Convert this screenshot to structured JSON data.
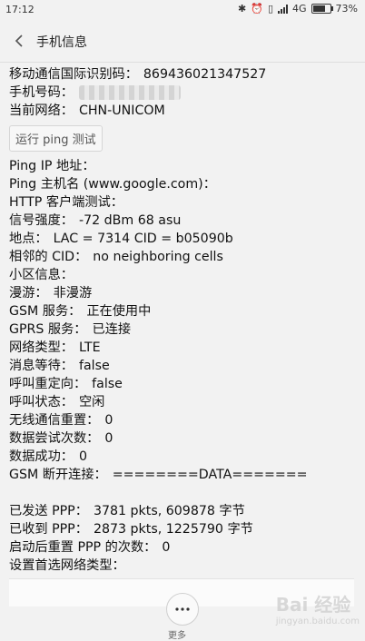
{
  "status": {
    "time": "17:12",
    "network": "4G",
    "battery": "73%",
    "battery_level": 0.73
  },
  "header": {
    "title": "手机信息"
  },
  "info": [
    {
      "label": "移动通信国际识别码：",
      "value": "869436021347527"
    },
    {
      "label": "手机号码：",
      "value": ""
    },
    {
      "label": "当前网络：",
      "value": "CHN-UNICOM"
    }
  ],
  "ping_button": "运行 ping 测试",
  "details": [
    {
      "label": "Ping IP 地址：",
      "value": ""
    },
    {
      "label": "Ping 主机名 (www.google.com)：",
      "value": ""
    },
    {
      "label": "HTTP 客户端测试：",
      "value": ""
    },
    {
      "label": "信号强度：",
      "value": "-72 dBm   68 asu"
    },
    {
      "label": "地点：",
      "value": "LAC = 7314   CID = b05090b"
    },
    {
      "label": "相邻的 CID：",
      "value": "no neighboring cells"
    },
    {
      "label": "小区信息：",
      "value": ""
    },
    {
      "label": "漫游：",
      "value": "非漫游"
    },
    {
      "label": "GSM 服务：",
      "value": "正在使用中"
    },
    {
      "label": "GPRS 服务：",
      "value": "已连接"
    },
    {
      "label": "网络类型：",
      "value": "LTE"
    },
    {
      "label": "消息等待：",
      "value": "false"
    },
    {
      "label": "呼叫重定向：",
      "value": "false"
    },
    {
      "label": "呼叫状态：",
      "value": "空闲"
    },
    {
      "label": "无线通信重置：",
      "value": "0"
    },
    {
      "label": "数据尝试次数：",
      "value": "0"
    },
    {
      "label": "数据成功：",
      "value": "0"
    },
    {
      "label": "GSM 断开连接：",
      "value": "========DATA======="
    }
  ],
  "ppp": [
    {
      "label": "已发送 PPP：",
      "value": "3781 pkts, 609878 字节"
    },
    {
      "label": "已收到 PPP：",
      "value": "2873 pkts, 1225790 字节"
    },
    {
      "label": "启动后重置 PPP 的次数：",
      "value": "0"
    },
    {
      "label": "设置首选网络类型：",
      "value": ""
    }
  ],
  "bottom": {
    "more_label": "更多"
  },
  "watermark": {
    "text": "Bai 经验",
    "sub": "jingyan.baidu.com"
  }
}
